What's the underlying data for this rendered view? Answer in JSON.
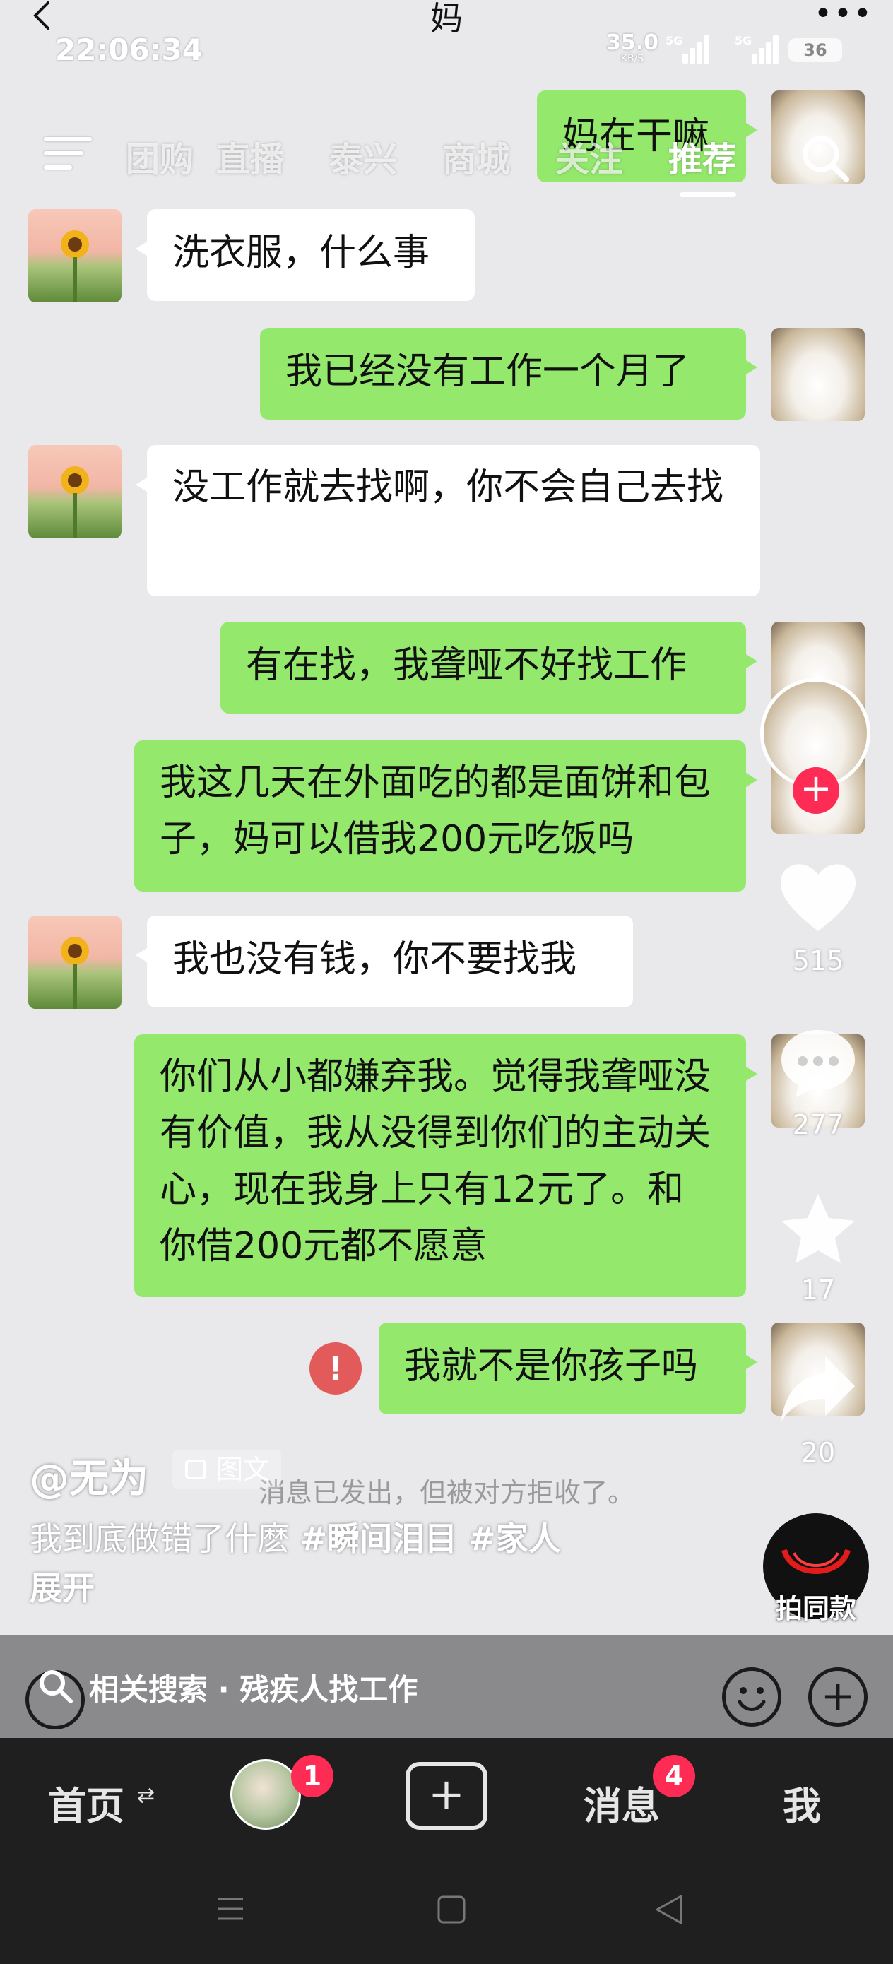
{
  "status_bar": {
    "time": "22:06:34",
    "net_speed": "35.0",
    "net_unit": "KB/S",
    "signal1": "5G",
    "signal2": "5G",
    "battery": "36"
  },
  "chat_header": {
    "title": "妈"
  },
  "top_nav": {
    "tabs": [
      {
        "label": "团购"
      },
      {
        "label": "直播"
      },
      {
        "label": "泰兴"
      },
      {
        "label": "商城"
      },
      {
        "label": "关注"
      },
      {
        "label": "推荐"
      }
    ],
    "active_tab": "推荐"
  },
  "messages": [
    {
      "from": "me",
      "text": "妈在干嘛"
    },
    {
      "from": "mom",
      "text": "洗衣服，什么事"
    },
    {
      "from": "me",
      "text": "我已经没有工作一个月了"
    },
    {
      "from": "mom",
      "text": "没工作就去找啊，你不会自己去找"
    },
    {
      "from": "me",
      "text": "有在找，我聋哑不好找工作"
    },
    {
      "from": "me",
      "text": "我这几天在外面吃的都是面饼和包子，妈可以借我200元吃饭吗"
    },
    {
      "from": "mom",
      "text": "我也没有钱，你不要找我"
    },
    {
      "from": "me",
      "text": "你们从小都嫌弃我。觉得我聋哑没有价值，我从没得到你们的主动关心，现在我身上只有12元了。和你借200元都不愿意"
    },
    {
      "from": "me",
      "text": "我就不是你孩子吗"
    }
  ],
  "send_error_icon": "!",
  "reject_notice": "消息已发出，但被对方拒收了。",
  "actions": {
    "likes": "515",
    "comments": "277",
    "favorites": "17",
    "shares": "20",
    "same_style_label": "拍同款"
  },
  "post": {
    "author": "@无为",
    "type_badge": "图文",
    "caption_text": "我到底做错了什麽 ",
    "hashtag1": "#瞬间泪目",
    "hashtag2": " #家人",
    "expand": "展开"
  },
  "related_search": {
    "text": "相关搜索 · 残疾人找工作"
  },
  "tabbar": {
    "home": "首页",
    "friends_badge": "1",
    "create_icon": "plus-icon",
    "messages": "消息",
    "messages_badge": "4",
    "me": "我"
  },
  "colors": {
    "my_bubble": "#94e96d",
    "their_bubble": "#ffffff",
    "accent_red": "#fe2c55",
    "error_red": "#e25a5a"
  }
}
